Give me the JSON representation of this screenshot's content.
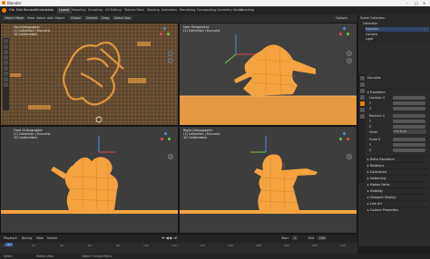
{
  "window": {
    "title": "Blender"
  },
  "menu": {
    "items": [
      "File",
      "Edit",
      "Render",
      "Window",
      "Help"
    ]
  },
  "workspaces": {
    "tabs": [
      "Layout",
      "Modeling",
      "Sculpting",
      "UV Editing",
      "Texture Paint",
      "Shading",
      "Animation",
      "Rendering",
      "Compositing",
      "Geometry Nodes",
      "Scripting"
    ],
    "active": "Layout"
  },
  "toolheader": {
    "mode": "Object Mode",
    "view": "View",
    "select": "Select",
    "add": "Add",
    "object": "Object",
    "orientation": "Global",
    "pivot": "Default",
    "drag": "Drag",
    "select_box": "Select Box",
    "options": "Options"
  },
  "viewports": {
    "top_left": {
      "line1": "Top Orthographic",
      "line2": "(1) Collection | Eunuchs",
      "line3": "10 Centimeters"
    },
    "top_right": {
      "line1": "User Perspective",
      "line2": "(1) Collection | Eunuchs"
    },
    "bottom_left": {
      "line1": "Front Orthographic",
      "line2": "(1) Collection | Eunuchs",
      "line3": "10 Centimeters"
    },
    "bottom_right": {
      "line1": "Right Orthographic",
      "line2": "(1) Collection | Eunuchs",
      "line3": "10 Centimeters"
    }
  },
  "outliner": {
    "rows": [
      "Scene Collection",
      "Collection",
      "Eunuchs",
      "Camera",
      "Light"
    ]
  },
  "properties": {
    "object_name": "Eunuchs",
    "sections": [
      "Transform",
      "Delta Transform",
      "Relations",
      "Collections",
      "Instancing",
      "Motion Paths",
      "Visibility",
      "Viewport Display",
      "Line Art",
      "Custom Properties"
    ],
    "transform_labels": [
      "Location X",
      "Y",
      "Z",
      "Rotation X",
      "Y",
      "Z",
      "Mode",
      "Scale X",
      "Y",
      "Z"
    ],
    "mode_value": "XYZ Euler"
  },
  "timeline": {
    "menu": [
      "Playback",
      "Keying",
      "View",
      "Marker"
    ],
    "ticks": [
      "0",
      "20",
      "40",
      "60",
      "80",
      "100",
      "120",
      "140",
      "160",
      "180",
      "200",
      "220",
      "240"
    ],
    "start_label": "Start",
    "start": "1",
    "end_label": "End",
    "end": "250"
  },
  "status": {
    "left": "Select",
    "mid": "Rotate View",
    "right": "Object Context Menu"
  },
  "colors": {
    "mesh": "#f4a340",
    "grid_bg": "#3d3d3d",
    "accent": "#4772b3"
  }
}
